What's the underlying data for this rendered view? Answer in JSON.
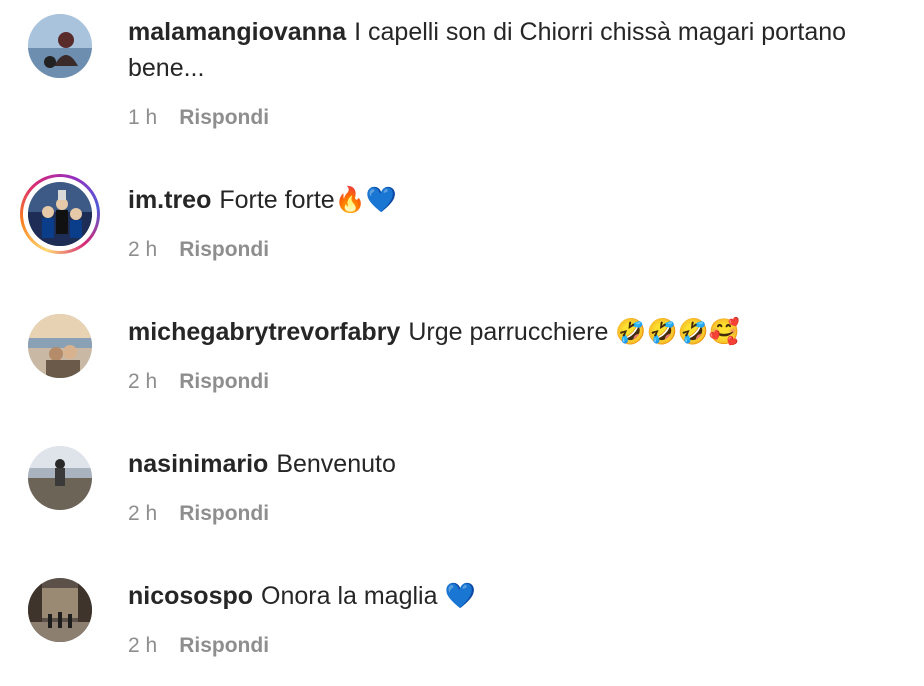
{
  "comments": [
    {
      "username": "malamangiovanna",
      "text": "I capelli son di Chiorri chissà magari portano bene...",
      "time": "1 h",
      "reply_label": "Rispondi",
      "avatar_icon": "profile-photo"
    },
    {
      "username": "im.treo",
      "text": "Forte forte🔥💙",
      "time": "2 h",
      "reply_label": "Rispondi",
      "avatar_icon": "profile-photo-with-story-ring"
    },
    {
      "username": "michegabrytrevorfabry",
      "text": "Urge parrucchiere 🤣🤣🤣🥰",
      "time": "2 h",
      "reply_label": "Rispondi",
      "avatar_icon": "profile-photo"
    },
    {
      "username": "nasinimario",
      "text": "Benvenuto",
      "time": "2 h",
      "reply_label": "Rispondi",
      "avatar_icon": "profile-photo"
    },
    {
      "username": "nicosospo",
      "text": "Onora la maglia 💙",
      "time": "2 h",
      "reply_label": "Rispondi",
      "avatar_icon": "profile-photo"
    }
  ],
  "colors": {
    "text": "#262626",
    "secondary": "#8e8e8e",
    "background": "#ffffff"
  }
}
